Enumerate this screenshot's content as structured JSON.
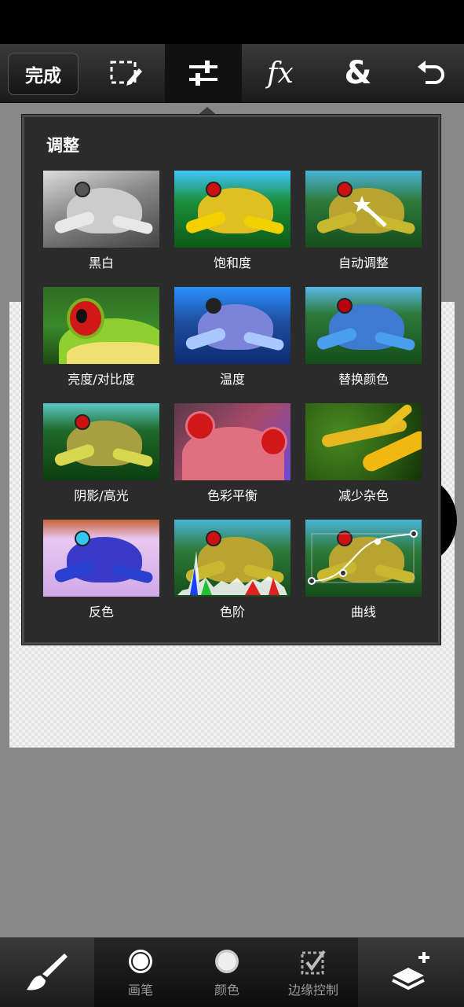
{
  "toolbar": {
    "done_label": "完成",
    "tools": [
      {
        "name": "selection-tool",
        "icon": "selection-edit-icon"
      },
      {
        "name": "adjustments-tool",
        "icon": "sliders-icon",
        "active": true
      },
      {
        "name": "effects-tool",
        "icon": "fx-icon",
        "glyph": "fx"
      },
      {
        "name": "combine-tool",
        "icon": "ampersand-icon",
        "glyph": "&"
      },
      {
        "name": "undo-tool",
        "icon": "undo-icon"
      }
    ]
  },
  "panel": {
    "title": "调整",
    "items": [
      {
        "label": "黑白"
      },
      {
        "label": "饱和度"
      },
      {
        "label": "自动调整"
      },
      {
        "label": "亮度/对比度"
      },
      {
        "label": "温度"
      },
      {
        "label": "替换颜色"
      },
      {
        "label": "阴影/高光"
      },
      {
        "label": "色彩平衡"
      },
      {
        "label": "减少杂色"
      },
      {
        "label": "反色"
      },
      {
        "label": "色阶"
      },
      {
        "label": "曲线"
      }
    ]
  },
  "bottom_bar": {
    "brush_label": "画笔",
    "color_label": "颜色",
    "edge_label": "边缘控制"
  },
  "colors": {
    "background": "#888888",
    "panel": "#2b2b2b",
    "toolbar": "#2a2a2a"
  }
}
